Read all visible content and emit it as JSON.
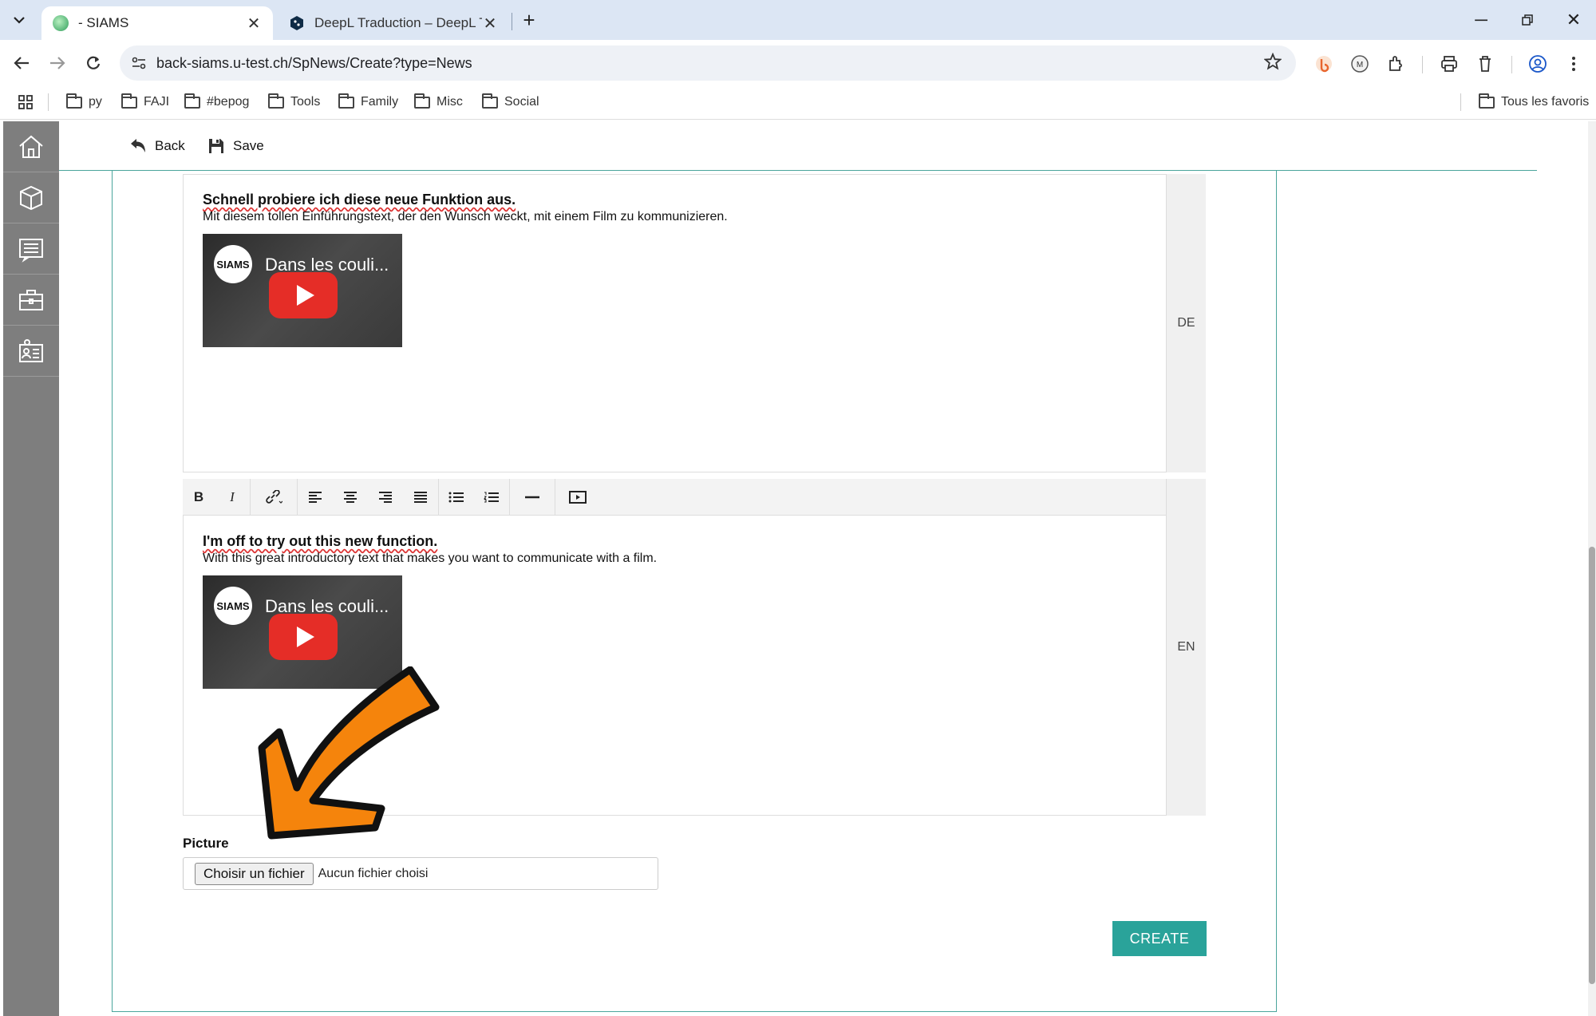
{
  "browser": {
    "tabs": [
      {
        "label": "- SIAMS",
        "active": true
      },
      {
        "label": "DeepL Traduction – DeepL Trans",
        "active": false
      }
    ],
    "url": "back-siams.u-test.ch/SpNews/Create?type=News",
    "bookmarks": [
      "py",
      "FAJI",
      "#bepog",
      "Tools",
      "Family",
      "Misc",
      "Social"
    ],
    "all_bookmarks_label": "Tous les favoris"
  },
  "sidebar": {
    "items": [
      "home-icon",
      "box-icon",
      "document-list-icon",
      "briefcase-icon",
      "id-card-icon"
    ]
  },
  "actions": {
    "back_label": "Back",
    "save_label": "Save"
  },
  "editor_de": {
    "lang": "DE",
    "title": "Schnell probiere ich diese neue Funktion aus.",
    "text": "Mit diesem tollen Einführungstext, der den Wunsch weckt, mit einem Film zu kommunizieren.",
    "video_title": "Dans les couli..."
  },
  "editor_en": {
    "lang": "EN",
    "title": "I'm off to try out this new function.",
    "text": "With this great introductory text that makes you want to communicate with a film.",
    "video_title": "Dans les couli..."
  },
  "editor_toolbar": {
    "bold": "B",
    "italic": "I"
  },
  "video_logo": "SIAMS",
  "picture": {
    "label": "Picture",
    "choose_label": "Choisir un fichier",
    "no_file_label": "Aucun fichier choisi"
  },
  "create_label": "CREATE",
  "colors": {
    "accent": "#2aa39a",
    "sidebar": "#7e7e7e",
    "arrow": "#f5840c"
  }
}
